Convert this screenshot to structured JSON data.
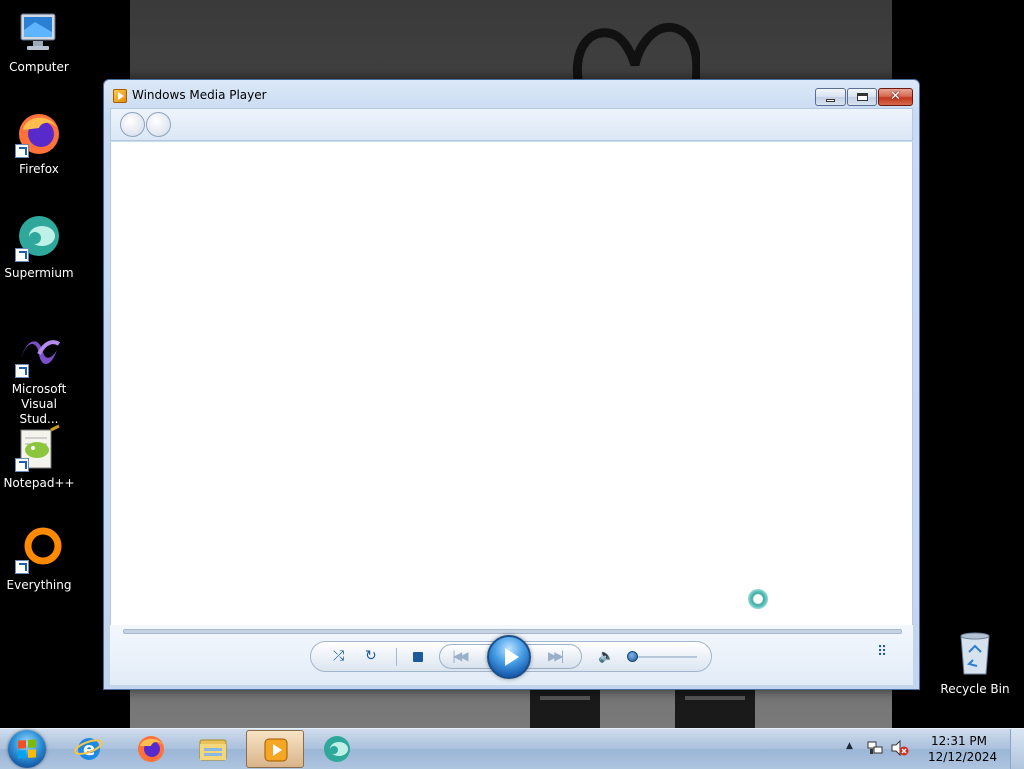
{
  "desktop": {
    "icons": [
      {
        "label": "Computer",
        "icon": "computer-icon"
      },
      {
        "label": "Firefox",
        "icon": "firefox-icon"
      },
      {
        "label": "Supermium",
        "icon": "supermium-icon"
      },
      {
        "label": "Microsoft Visual Stud...",
        "icon": "visual-studio-icon"
      },
      {
        "label": "Notepad++",
        "icon": "notepad-plus-plus-icon"
      },
      {
        "label": "Everything",
        "icon": "everything-icon"
      },
      {
        "label": "Recycle Bin",
        "icon": "recycle-bin-icon"
      }
    ]
  },
  "window": {
    "title": "Windows Media Player",
    "caption_buttons": [
      "minimize",
      "maximize",
      "close"
    ],
    "controls": {
      "shuffle_glyph": "⤮",
      "repeat_glyph": "↻",
      "prev_glyph": "|◀◀",
      "next_glyph": "▶▶|",
      "mute_glyph": "🔈",
      "switch_view_glyph": "⠿",
      "volume_level": 0.05
    }
  },
  "taskbar": {
    "pinned": [
      "internet-explorer",
      "firefox",
      "windows-explorer",
      "windows-media-player",
      "supermium"
    ],
    "active": "windows-media-player",
    "clock": {
      "time": "12:31 PM",
      "date": "12/12/2024"
    }
  },
  "colors": {
    "accent": "#1d5a9c",
    "taskbar": "#a9c0dc",
    "window_frame": "#c8dbf2"
  }
}
